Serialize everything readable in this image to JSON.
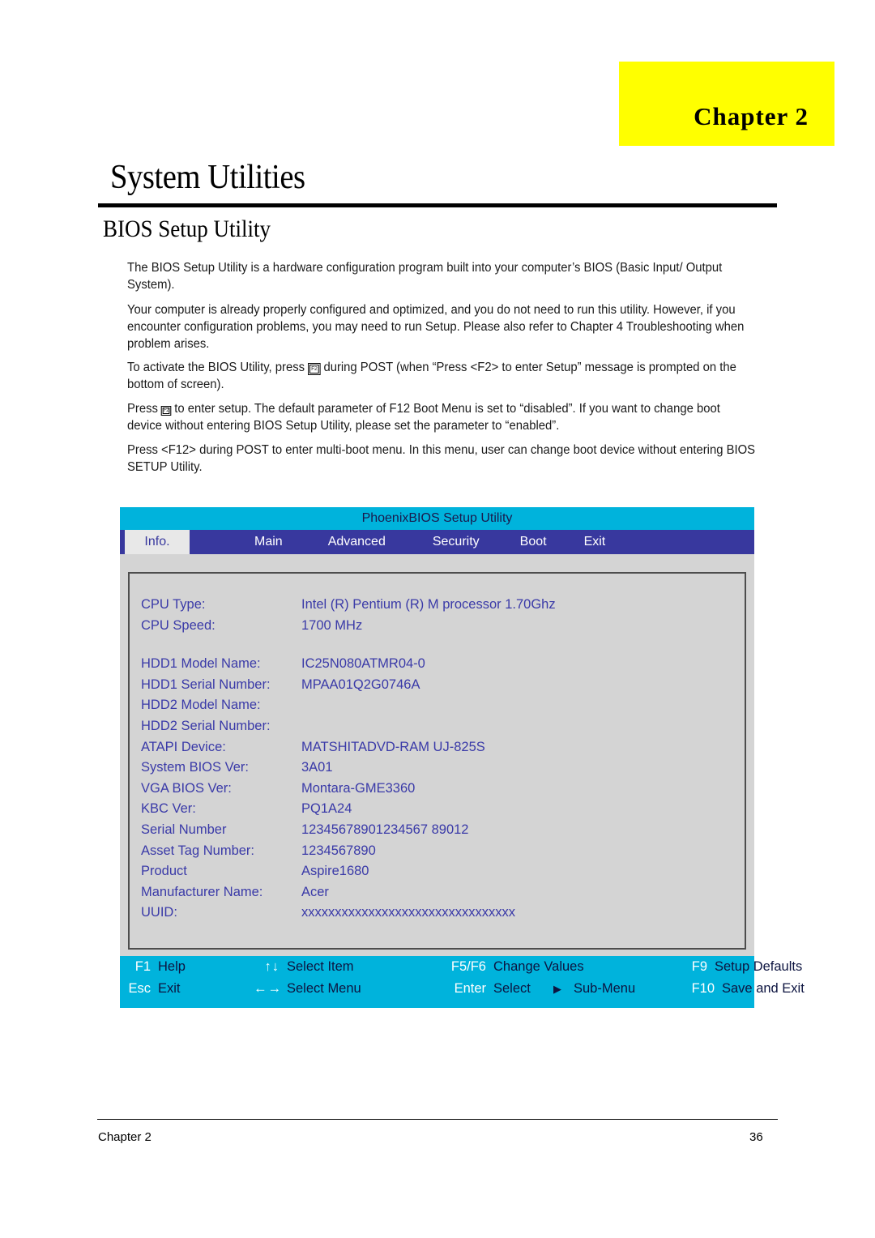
{
  "chapter_banner": {
    "label": "Chapter  2"
  },
  "page_title": "System Utilities",
  "section_title": "BIOS Setup Utility",
  "paragraphs": {
    "p1": "The BIOS Setup Utility is a hardware configuration program built into your computer’s BIOS (Basic Input/ Output System).",
    "p2": "Your computer is already properly configured and optimized, and you do not need to run this utility. However, if you encounter configuration problems, you may need to run Setup.  Please also refer to Chapter 4 Troubleshooting when problem arises.",
    "p3_before": "To activate the BIOS Utility, press",
    "p3_key": "F2",
    "p3_after": "during POST (when “Press <F2> to enter Setup” message is prompted on the bottom of screen).",
    "p4_before": "Press",
    "p4_key": "F2",
    "p4_after": "to enter setup. The default parameter of F12 Boot Menu is set to “disabled”. If you want to change boot device without entering BIOS Setup Utility, please set the parameter to “enabled”.",
    "p5": "Press <F12> during POST to enter multi-boot menu. In this menu, user can change boot device without entering BIOS SETUP Utility."
  },
  "bios": {
    "title": "PhoenixBIOS Setup Utility",
    "colors": {
      "titlebar": "#00b3dc",
      "tabbar": "#38389e",
      "active_tab_bg": "#e8e8e8",
      "panel_bg": "#d4d4d4",
      "text_blue": "#3a3aa8",
      "footer_bg": "#00b3dc"
    },
    "tabs": [
      {
        "label": "Info.",
        "active": true
      },
      {
        "label": "Main",
        "active": false
      },
      {
        "label": "Advanced",
        "active": false
      },
      {
        "label": "Security",
        "active": false
      },
      {
        "label": "Boot",
        "active": false
      },
      {
        "label": "Exit",
        "active": false
      }
    ],
    "rows": [
      {
        "label": "CPU Type:",
        "value": "Intel (R) Pentium (R) M processor 1.70Ghz"
      },
      {
        "label": "CPU Speed:",
        "value": "1700 MHz"
      },
      {
        "label": "",
        "value": ""
      },
      {
        "label": "HDD1 Model Name:",
        "value": "IC25N080ATMR04-0"
      },
      {
        "label": "HDD1 Serial Number:",
        "value": "MPAA01Q2G0746A"
      },
      {
        "label": "HDD2 Model Name:",
        "value": ""
      },
      {
        "label": "HDD2 Serial Number:",
        "value": ""
      },
      {
        "label": "ATAPI Device:",
        "value": "MATSHITADVD-RAM UJ-825S"
      },
      {
        "label": "System BIOS Ver:",
        "value": "3A01"
      },
      {
        "label": "VGA BIOS Ver:",
        "value": "Montara-GME3360"
      },
      {
        "label": "KBC Ver:",
        "value": "PQ1A24"
      },
      {
        "label": "Serial Number",
        "value": "12345678901234567 89012"
      },
      {
        "label": "Asset Tag Number:",
        "value": "1234567890"
      },
      {
        "label": "Product",
        "value": "Aspire1680"
      },
      {
        "label": "Manufacturer Name:",
        "value": "Acer"
      },
      {
        "label": "UUID:",
        "value": "xxxxxxxxxxxxxxxxxxxxxxxxxxxxxxxx"
      }
    ],
    "help": {
      "row1": [
        {
          "key": "F1",
          "desc": "Help"
        },
        {
          "key": "↑↓",
          "desc": "Select Item"
        },
        {
          "key": "F5/F6",
          "desc": "Change Values"
        },
        {
          "key": "F9",
          "desc": "Setup Defaults"
        }
      ],
      "row2": [
        {
          "key": "Esc",
          "desc": "Exit"
        },
        {
          "key": "←→",
          "desc": "Select Menu"
        },
        {
          "key": "Enter",
          "desc": "Select",
          "desc2": "Sub-Menu",
          "tri": "▶"
        },
        {
          "key": "F10",
          "desc": "Save and Exit"
        }
      ]
    }
  },
  "footer": {
    "left": "Chapter 2",
    "right": "36"
  }
}
